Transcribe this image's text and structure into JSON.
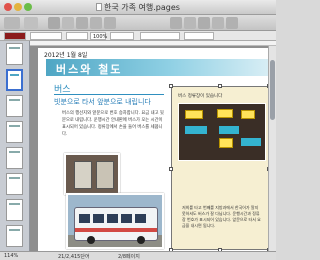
{
  "window": {
    "title": "한국 가족 여행.pages"
  },
  "format_bar": {
    "zoom": "100%"
  },
  "document": {
    "date_header": "2012년 1월 8일",
    "banner_title": "버스와 철도",
    "section_title": "버스",
    "subheading": "빗분으로 타서 앞분으로 내립니다",
    "body_text": "버스의 행선지와 앞문으로 번호 승차합니다. 요금 내고 뒷문으로 내립니다. 운행시간 안내판에 버스가 오는 시간이 표시되어 있습니다. 정류장에서 손을 들어 버스를 세웁니다.",
    "inset_title": "버스 정류장이 있습니다",
    "inset_text": "저희를 타고 번째를 지방과에서 한국어가 알지 못하셔도 버스가 잘 다닙니다. 운행시간과 정류장 번호가 표시되어 있습니다. 앞문으로 타서 요금을 내시면 됩니다."
  },
  "status": {
    "zoom": "114%",
    "word_count": "21/2,415단어",
    "page_count": "2/8페이지"
  }
}
